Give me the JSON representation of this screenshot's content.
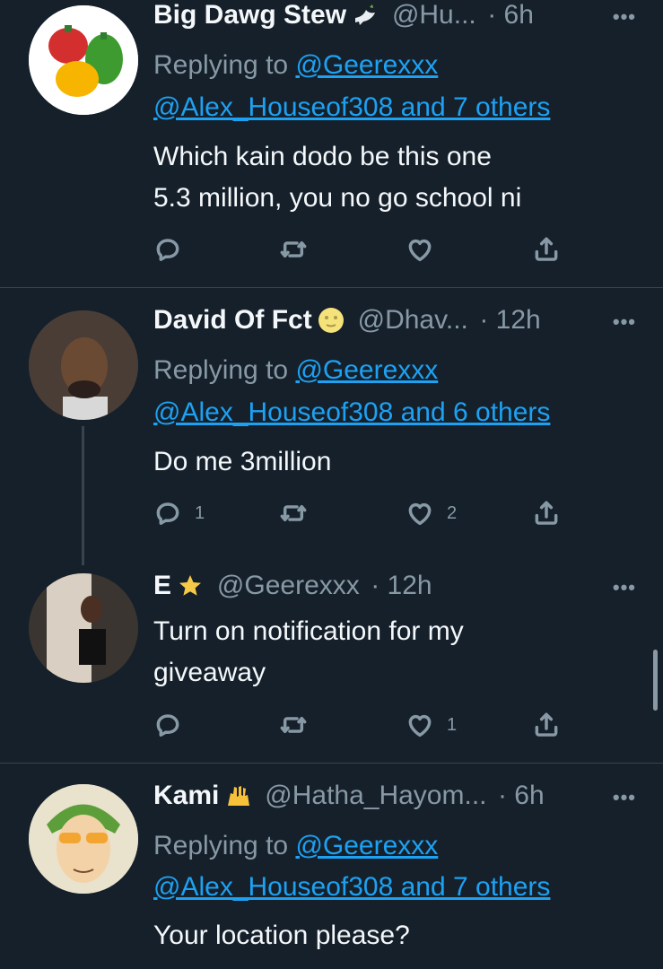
{
  "tweets": [
    {
      "name": "Big Dawg Stew",
      "handle": "@Hu...",
      "time": "· 6h",
      "replying_prefix": "Replying to ",
      "replying_to": "@Geerexxx",
      "replying_others": "@Alex_Houseof308 and 7 others",
      "text_lines": [
        "Which kain dodo be this one",
        "5.3 million, you no go school ni"
      ],
      "reply_count": "",
      "retweet_count": "",
      "like_count": ""
    },
    {
      "name": "David Of Fct",
      "handle": "@Dhav...",
      "time": "· 12h",
      "replying_prefix": "Replying to ",
      "replying_to": "@Geerexxx",
      "replying_others": "@Alex_Houseof308 and 6 others",
      "text_lines": [
        "Do me 3million"
      ],
      "reply_count": "1",
      "retweet_count": "",
      "like_count": "2"
    },
    {
      "name": "E",
      "handle": "@Geerexxx",
      "time": "· 12h",
      "text_lines": [
        "Turn on notification for my",
        "giveaway"
      ],
      "reply_count": "",
      "retweet_count": "",
      "like_count": "1"
    },
    {
      "name": "Kami",
      "handle": "@Hatha_Hayom...",
      "time": "· 6h",
      "replying_prefix": "Replying to ",
      "replying_to": "@Geerexxx",
      "replying_others": "@Alex_Houseof308 and 7 others",
      "text_lines": [
        "Your location please?"
      ]
    }
  ],
  "more_label": "•••",
  "colors": {
    "background": "#15202b",
    "link": "#1da1f2",
    "muted": "#8899a6",
    "text": "#f5f8fa"
  }
}
